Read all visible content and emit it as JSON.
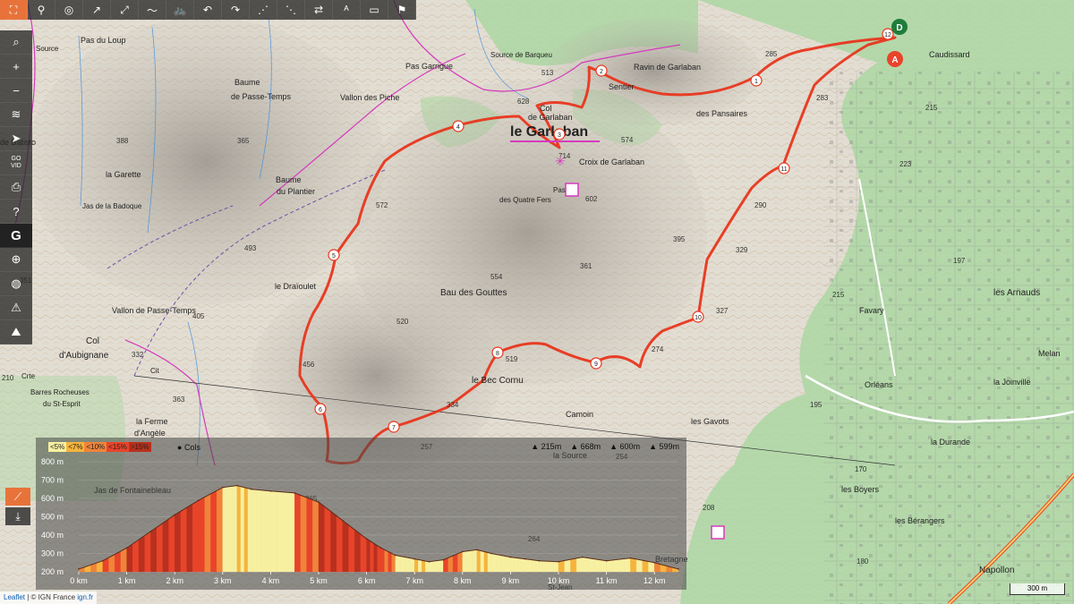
{
  "toolbar": {
    "top": [
      {
        "name": "fullscreen-icon",
        "glyph": "⛶"
      },
      {
        "name": "route-icon",
        "glyph": "⚲"
      },
      {
        "name": "hide-icon",
        "glyph": "◎"
      },
      {
        "name": "draw-line-icon",
        "glyph": "↗"
      },
      {
        "name": "draw-segment-icon",
        "glyph": "⤢"
      },
      {
        "name": "freehand-icon",
        "glyph": "〜"
      },
      {
        "name": "bike-icon",
        "glyph": "🚲"
      },
      {
        "name": "undo-icon",
        "glyph": "↶"
      },
      {
        "name": "redo-icon",
        "glyph": "↷"
      },
      {
        "name": "waypoints-icon",
        "glyph": "⋰"
      },
      {
        "name": "nodes-icon",
        "glyph": "⋱"
      },
      {
        "name": "reverse-icon",
        "glyph": "⇄"
      },
      {
        "name": "text-direction-icon",
        "glyph": "ᴬ"
      },
      {
        "name": "crop-icon",
        "glyph": "▭"
      },
      {
        "name": "marker-icon",
        "glyph": "⚑"
      }
    ],
    "left": [
      {
        "name": "search-icon",
        "glyph": "⌕"
      },
      {
        "name": "zoom-in-icon",
        "glyph": "+"
      },
      {
        "name": "zoom-out-icon",
        "glyph": "−"
      },
      {
        "name": "layers-icon",
        "glyph": "≋"
      },
      {
        "name": "locate-icon",
        "glyph": "➤"
      },
      {
        "name": "gpx-icon",
        "glyph": "GO\nVID"
      },
      {
        "name": "print-icon",
        "glyph": "⎙"
      },
      {
        "name": "help-icon",
        "glyph": "?"
      },
      {
        "name": "google-icon",
        "glyph": "G"
      },
      {
        "name": "crosshair-icon",
        "glyph": "⊕"
      },
      {
        "name": "globe-icon",
        "glyph": "◍"
      },
      {
        "name": "hiker-icon",
        "glyph": "⚠"
      },
      {
        "name": "terrain-icon",
        "glyph": "⛰"
      }
    ]
  },
  "map_labels": [
    {
      "text": "Pas du Loup",
      "size": 9
    },
    {
      "text": "Source",
      "size": 8
    },
    {
      "text": "Source de Barqueu",
      "size": 8
    },
    {
      "text": "Pas Garrigue",
      "size": 9
    },
    {
      "text": "Baume",
      "size": 9
    },
    {
      "text": "de Passe-Temps",
      "size": 9
    },
    {
      "text": "Vallon des Piche",
      "size": 9
    },
    {
      "text": "de Batisto",
      "size": 9
    },
    {
      "text": "la Garette",
      "size": 9
    },
    {
      "text": "Jas de la Badoque",
      "size": 8
    },
    {
      "text": "Baume",
      "size": 9
    },
    {
      "text": "du Plantier",
      "size": 9
    },
    {
      "text": "Col",
      "size": 9
    },
    {
      "text": "de Garlaban",
      "size": 9
    },
    {
      "text": "le Garlaban",
      "size": 16
    },
    {
      "text": "Croix de Garlaban",
      "size": 9
    },
    {
      "text": "Pas",
      "size": 8
    },
    {
      "text": "des Quatre Fers",
      "size": 8
    },
    {
      "text": "Sentier",
      "size": 9
    },
    {
      "text": "Ravin de Garlaban",
      "size": 9
    },
    {
      "text": "des Pansaires",
      "size": 9
    },
    {
      "text": "le Draïoulet",
      "size": 9
    },
    {
      "text": "Bau des Gouttes",
      "size": 10
    },
    {
      "text": "Col",
      "size": 10
    },
    {
      "text": "d'Aubignane",
      "size": 10
    },
    {
      "text": "Barres Rocheuses",
      "size": 8
    },
    {
      "text": "du St-Esprit",
      "size": 8
    },
    {
      "text": "la Ferme",
      "size": 9
    },
    {
      "text": "d'Angèle",
      "size": 9
    },
    {
      "text": "le Bec Cornu",
      "size": 10
    },
    {
      "text": "Camoin",
      "size": 9
    },
    {
      "text": "les Gavots",
      "size": 9
    },
    {
      "text": "Caudissard",
      "size": 9
    },
    {
      "text": "les Arnauds",
      "size": 10
    },
    {
      "text": "Favary",
      "size": 9
    },
    {
      "text": "Melan",
      "size": 9
    },
    {
      "text": "Orléans",
      "size": 9
    },
    {
      "text": "la Joinville",
      "size": 9
    },
    {
      "text": "la Durande",
      "size": 9
    },
    {
      "text": "les Boyers",
      "size": 9
    },
    {
      "text": "les Bérangers",
      "size": 9
    },
    {
      "text": "Bretagne",
      "size": 9
    },
    {
      "text": "Napollon",
      "size": 10
    },
    {
      "text": "Jas de Fontainebleau",
      "size": 9
    },
    {
      "text": "la Source",
      "size": 9
    },
    {
      "text": "Vallon de Passe-Temps",
      "size": 9
    },
    {
      "text": "Crte",
      "size": 8
    },
    {
      "text": "Cit",
      "size": 8
    },
    {
      "text": "St-Jean",
      "size": 8
    }
  ],
  "spot_heights": [
    "388",
    "365",
    "493",
    "572",
    "628",
    "513",
    "574",
    "714",
    "602",
    "395",
    "361",
    "554",
    "520",
    "456",
    "405",
    "351",
    "332",
    "210",
    "363",
    "334",
    "519",
    "285",
    "274",
    "327",
    "329",
    "290",
    "283",
    "215",
    "223",
    "197",
    "215",
    "195",
    "170",
    "208",
    "180",
    "265",
    "257",
    "254",
    "264"
  ],
  "route_markers": [
    "1",
    "2",
    "3",
    "4",
    "5",
    "6",
    "7",
    "8",
    "9",
    "10",
    "11",
    "12"
  ],
  "endpoints": {
    "start": "D",
    "end": "A"
  },
  "profile": {
    "legend": [
      "<5%",
      "<7%",
      "<10%",
      "<15%",
      ">15%"
    ],
    "legend_colors": [
      "#f7f0a0",
      "#f6b43c",
      "#f0843a",
      "#e8442a",
      "#b8301e"
    ],
    "cols_label": "Cols",
    "stats": [
      {
        "icon": "min-alt-icon",
        "value": "215m"
      },
      {
        "icon": "ascent-icon",
        "value": "668m"
      },
      {
        "icon": "max-alt-icon",
        "value": "600m"
      },
      {
        "icon": "descent-icon",
        "value": "599m"
      }
    ],
    "y_ticks": [
      "800 m",
      "700 m",
      "600 m",
      "500 m",
      "400 m",
      "300 m",
      "200 m"
    ],
    "x_ticks": [
      "0 km",
      "1 km",
      "2 km",
      "3 km",
      "4 km",
      "5 km",
      "6 km",
      "7 km",
      "8 km",
      "9 km",
      "10 km",
      "11 km",
      "12 km"
    ]
  },
  "chart_data": {
    "type": "area",
    "xlabel": "",
    "ylabel": "",
    "ylim": [
      200,
      800
    ],
    "xlim": [
      0,
      12.5
    ],
    "x": [
      0,
      0.5,
      1,
      1.5,
      2,
      2.5,
      3,
      3.3,
      3.6,
      4,
      4.5,
      5,
      5.5,
      6,
      6.3,
      6.6,
      7,
      7.3,
      7.6,
      8,
      8.3,
      8.6,
      9,
      9.3,
      9.6,
      10,
      10.5,
      11,
      11.5,
      12,
      12.5
    ],
    "y": [
      215,
      260,
      330,
      420,
      510,
      590,
      660,
      670,
      650,
      640,
      630,
      580,
      480,
      380,
      330,
      290,
      270,
      255,
      265,
      310,
      320,
      300,
      280,
      270,
      260,
      255,
      280,
      260,
      275,
      250,
      215
    ]
  },
  "side_buttons": [
    {
      "name": "profile-chart-icon",
      "glyph": "⟋"
    },
    {
      "name": "download-icon",
      "glyph": "⤓"
    }
  ],
  "attribution": {
    "leaflet": "Leaflet",
    "sep": " | © IGN France ",
    "ign": "ign.fr"
  },
  "scale_label": "300 m",
  "colors": {
    "route": "#e8361e",
    "contour": "#c9a98a",
    "forest": "#9fd49a",
    "hillshade": "#bdb8b0"
  }
}
